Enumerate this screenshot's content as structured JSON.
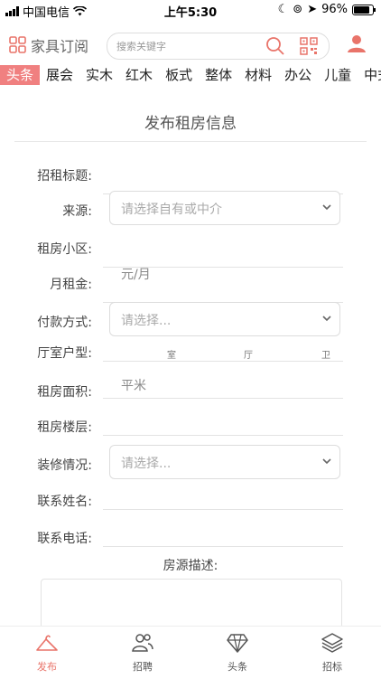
{
  "status_bar": {
    "carrier": "中国电信",
    "time": "上午5:30",
    "battery": "96%"
  },
  "header": {
    "logo_text": "家具订阅",
    "search_placeholder": "搜索关键字"
  },
  "categories": [
    "头条",
    "展会",
    "实木",
    "红木",
    "板式",
    "整体",
    "材料",
    "办公",
    "儿童",
    "中式"
  ],
  "form": {
    "title": "发布租房信息",
    "labels": {
      "title": "招租标题:",
      "source": "来源:",
      "community": "租房小区:",
      "rent": "月租金:",
      "payment": "付款方式:",
      "layout": "厅室户型:",
      "area": "租房面积:",
      "floor": "租房楼层:",
      "decoration": "装修情况:",
      "contact_name": "联系姓名:",
      "contact_phone": "联系电话:",
      "description": "房源描述:"
    },
    "source_placeholder": "请选择自有或中介",
    "rent_unit": "元/月",
    "payment_placeholder": "请选择...",
    "layout_units": {
      "room": "室",
      "hall": "厅",
      "bath": "卫"
    },
    "area_unit": "平米",
    "decoration_placeholder": "请选择..."
  },
  "tabbar": {
    "items": [
      "发布",
      "招聘",
      "头条",
      "招标"
    ],
    "active_index": 0
  },
  "colors": {
    "accent": "#e9746a",
    "active_category_bg": "#f08080"
  }
}
